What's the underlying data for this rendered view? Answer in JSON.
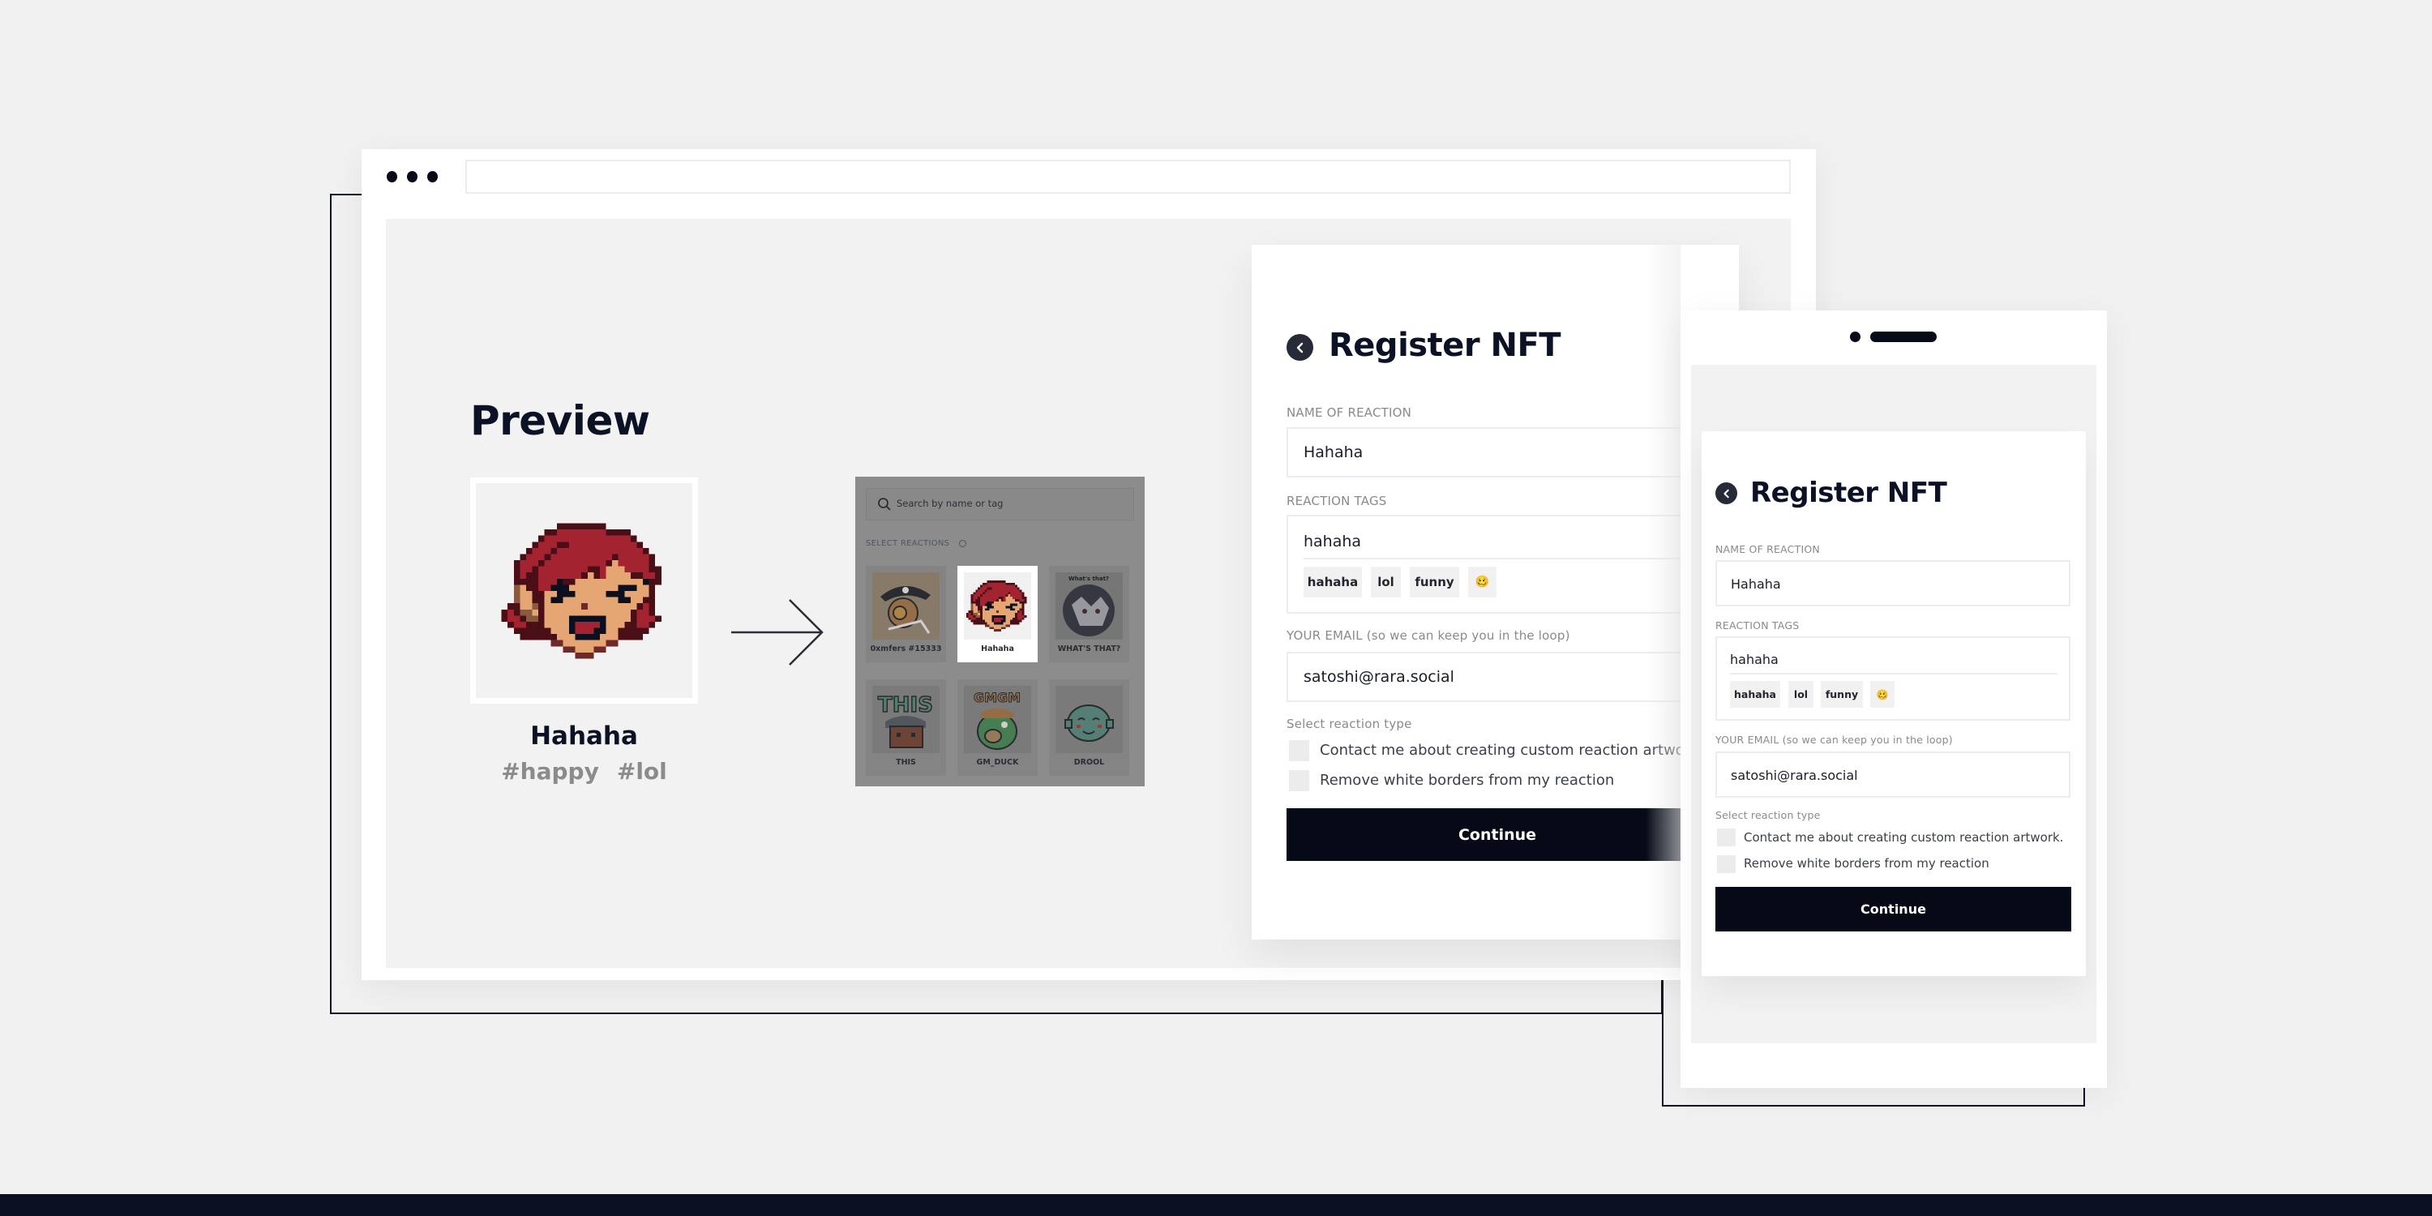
{
  "browser": {
    "window_dots": 3,
    "url": ""
  },
  "preview": {
    "title": "Preview",
    "image": "hahaha-pixel-face",
    "reaction_name": "Hahaha",
    "tags": [
      "#happy",
      "#lol"
    ]
  },
  "picker": {
    "search_placeholder": "Search by name or tag",
    "section_label": "SELECT REACTIONS",
    "info_icon": "info-icon",
    "items": [
      {
        "label": "0xmfers #15333",
        "image": "pirate-pixel-face",
        "selected": false
      },
      {
        "label": "Hahaha",
        "image": "hahaha-pixel-face",
        "selected": true
      },
      {
        "label": "WHAT'S THAT?",
        "image": "cat-photo-circle",
        "caption": "What's that?",
        "selected": false
      },
      {
        "label": "THIS",
        "image": "this-pixel-face",
        "selected": false
      },
      {
        "label": "GM_DUCK",
        "image": "gm-duck-pixel",
        "selected": false
      },
      {
        "label": "DROOL",
        "image": "drool-pixel-face",
        "selected": false
      }
    ]
  },
  "register_form": {
    "title": "Register NFT",
    "back_icon": "chevron-left-icon",
    "name_label": "NAME OF REACTION",
    "name_value": "Hahaha",
    "tags_label": "REACTION TAGS",
    "tags_input_value": "hahaha",
    "tag_chips": [
      "hahaha",
      "lol",
      "funny",
      "🥴"
    ],
    "email_label": "YOUR EMAIL (so we can keep you in the loop)",
    "email_value": "satoshi@rara.social",
    "type_label": "Select reaction type",
    "options": [
      {
        "label": "Contact me about creating custom reaction artwork.",
        "checked": false
      },
      {
        "label": "Remove white borders from my reaction",
        "checked": false
      }
    ],
    "continue_label": "Continue"
  },
  "colors": {
    "background": "#f1f1f1",
    "primary_dark": "#050a16",
    "title_text": "#0b1226",
    "muted_label": "#8a8a8a",
    "bottom_bar": "#0b1023",
    "hair_red": "#a32430"
  }
}
